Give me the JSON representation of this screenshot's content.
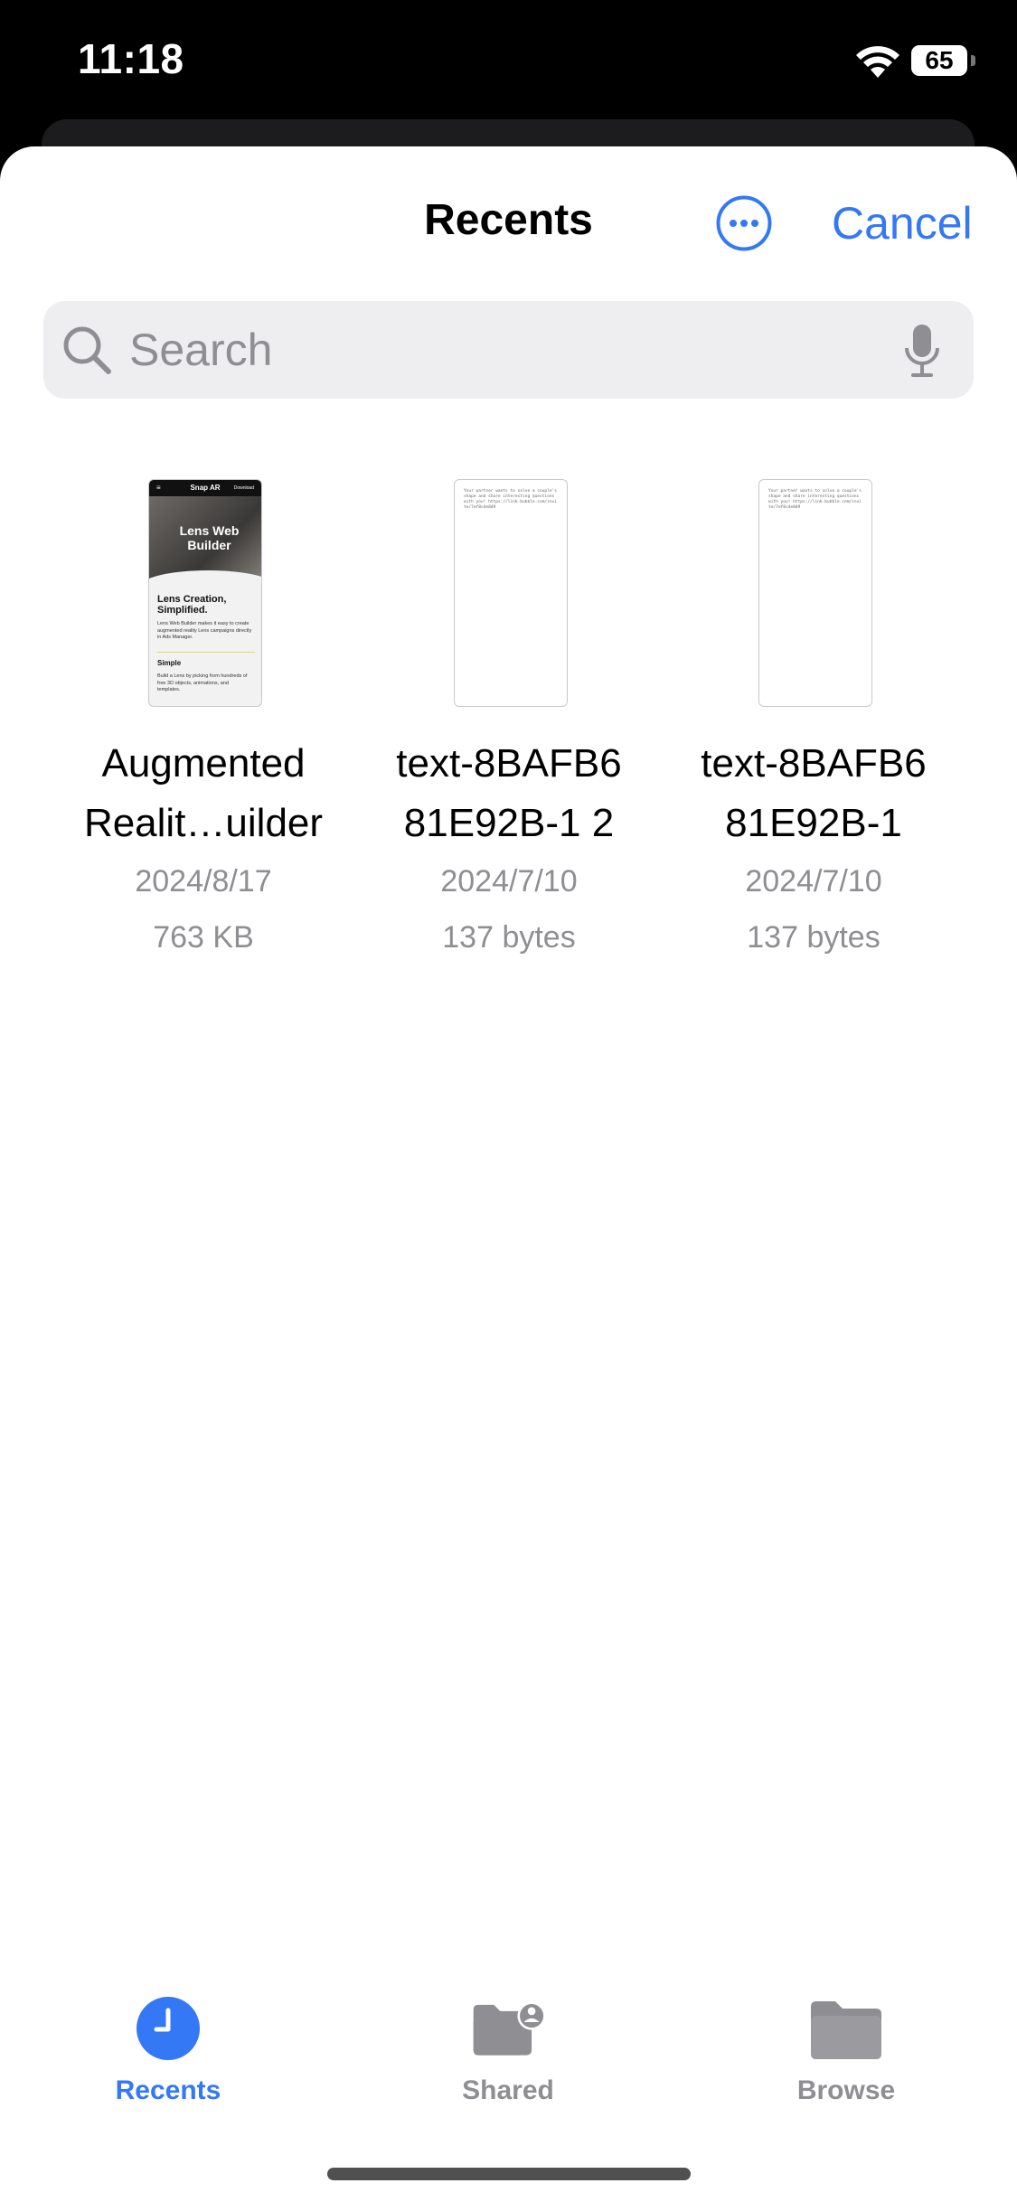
{
  "status_bar": {
    "time": "11:18",
    "battery": "65"
  },
  "sheet": {
    "title": "Recents",
    "cancel_label": "Cancel",
    "search_placeholder": "Search"
  },
  "files": [
    {
      "name_line1": "Augmented",
      "name_line2": "Realit…uilder",
      "date": "2024/8/17",
      "size": "763 KB",
      "thumb": {
        "menu": "≡",
        "brand": "Snap AR",
        "action": "Download",
        "hero": "Lens Web Builder",
        "heading": "Lens Creation, Simplified.",
        "body": "Lens Web Builder makes it easy to create augmented reality Lens campaigns directly in Ads Manager.",
        "subheading": "Simple",
        "body2": "Build a Lens by picking from hundreds of free 3D objects, animations, and templates."
      }
    },
    {
      "name_line1": "text-8BAFB6",
      "name_line2": "81E92B-1 2",
      "date": "2024/7/10",
      "size": "137 bytes",
      "thumb_text": "Your partner wants to solve a couple's shape and share interesting questions with you! https://link.bubble.com/invite/7ef8c4e8d9"
    },
    {
      "name_line1": "text-8BAFB6",
      "name_line2": "81E92B-1",
      "date": "2024/7/10",
      "size": "137 bytes",
      "thumb_text": "Your partner wants to solve a couple's shape and share interesting questions with you! https://link.bubble.com/invite/7ef8c4e8d9"
    }
  ],
  "tabs": [
    {
      "label": "Recents",
      "icon": "clock-icon",
      "active": true
    },
    {
      "label": "Shared",
      "icon": "shared-folder-icon",
      "active": false
    },
    {
      "label": "Browse",
      "icon": "folder-icon",
      "active": false
    }
  ],
  "colors": {
    "accent": "#3478f6",
    "secondary_text": "#8e8e93",
    "search_bg": "#eeeef0"
  }
}
